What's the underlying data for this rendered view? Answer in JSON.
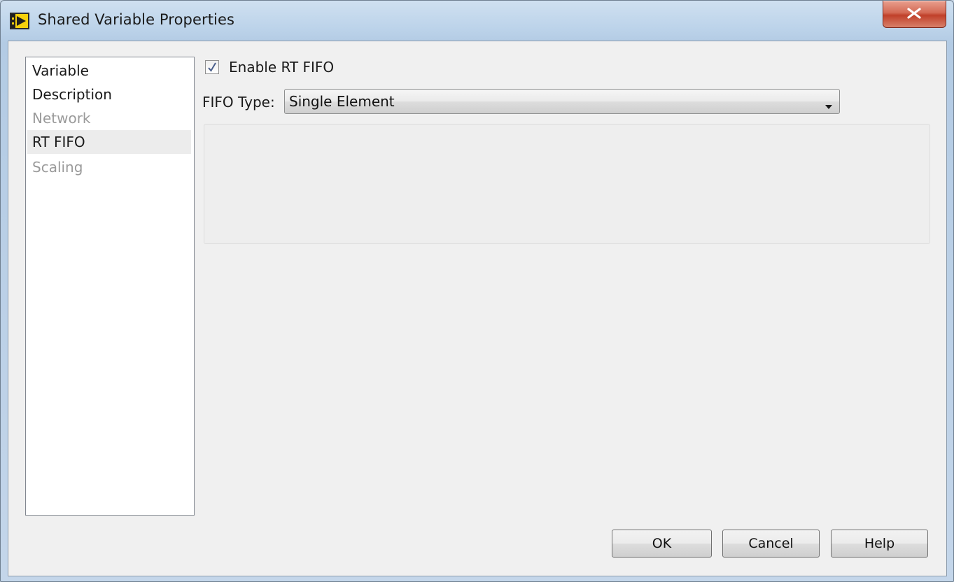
{
  "window": {
    "title": "Shared Variable Properties",
    "app_icon": "labview-vi-icon",
    "close_icon": "close-x-icon"
  },
  "categories": [
    {
      "label": "Variable",
      "state": "normal"
    },
    {
      "label": "Description",
      "state": "normal"
    },
    {
      "label": "Network",
      "state": "disabled"
    },
    {
      "label": "RT FIFO",
      "state": "selected"
    },
    {
      "label": "Scaling",
      "state": "disabled"
    }
  ],
  "rt_fifo": {
    "enable_label": "Enable RT FIFO",
    "enable_checked": true,
    "fifo_type_label": "FIFO Type:",
    "fifo_type_value": "Single Element"
  },
  "buttons": {
    "ok": "OK",
    "cancel": "Cancel",
    "help": "Help"
  },
  "colors": {
    "title_bar": "#bcd3ea",
    "close_button": "#c7452f",
    "dialog_bg": "#f0f0f0",
    "list_bg": "#ffffff",
    "disabled_text": "#9a9a9a"
  }
}
